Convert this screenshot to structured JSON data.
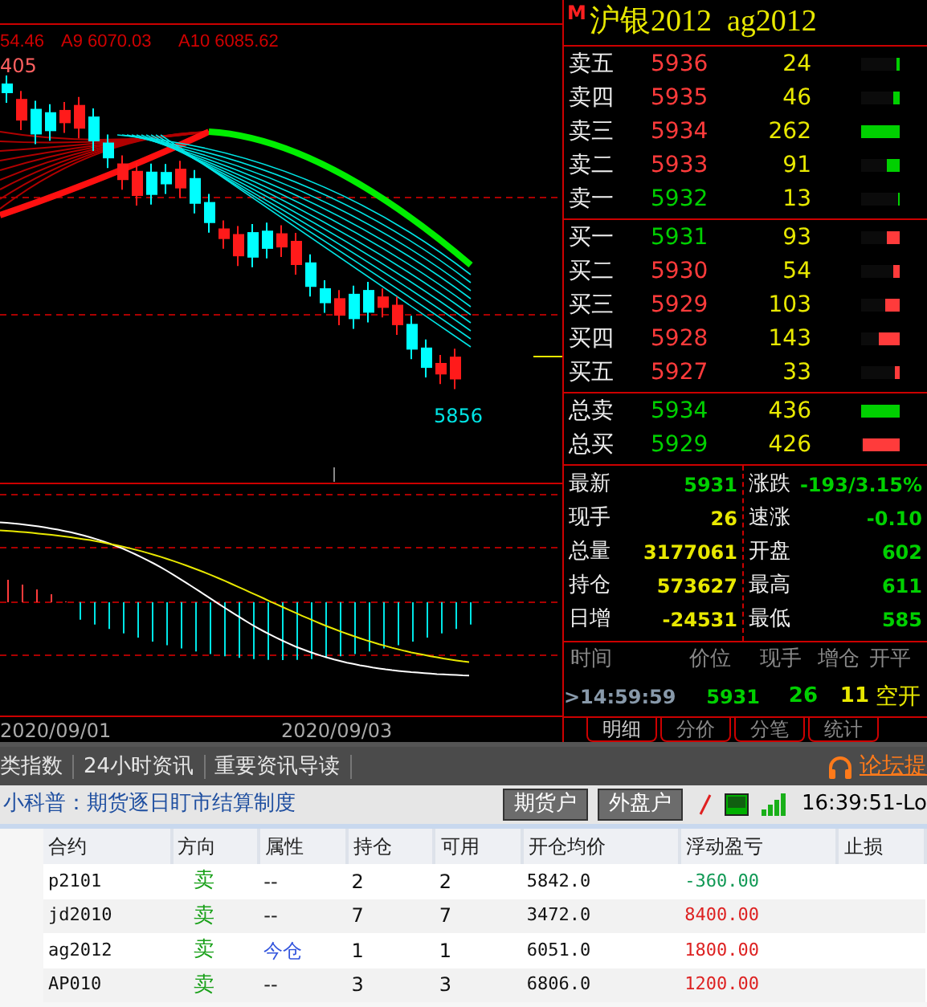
{
  "chart": {
    "ma_values": [
      "54.46",
      "A9 6070.03",
      "A10 6085.62"
    ],
    "high_label": "405",
    "low_label": "5856",
    "dates": [
      "2020/09/01",
      "2020/09/03"
    ]
  },
  "quote": {
    "badge": "M",
    "title": "沪银2012  ag2012",
    "asks": [
      {
        "label": "卖五",
        "price": "5936",
        "color": "#ff3b3b",
        "volume": "24",
        "level": 0.08,
        "kind": "sell"
      },
      {
        "label": "卖四",
        "price": "5935",
        "color": "#ff3b3b",
        "volume": "46",
        "level": 0.15,
        "kind": "sell"
      },
      {
        "label": "卖三",
        "price": "5934",
        "color": "#ff3b3b",
        "volume": "262",
        "level": 1,
        "kind": "sell"
      },
      {
        "label": "卖二",
        "price": "5933",
        "color": "#ff3b3b",
        "volume": "91",
        "level": 0.33,
        "kind": "sell"
      },
      {
        "label": "卖一",
        "price": "5932",
        "color": "#00d000",
        "volume": "13",
        "level": 0.04,
        "kind": "sell"
      }
    ],
    "bids": [
      {
        "label": "买一",
        "price": "5931",
        "color": "#00d000",
        "volume": "93",
        "level": 0.33,
        "kind": "buy"
      },
      {
        "label": "买二",
        "price": "5930",
        "color": "#ff3b3b",
        "volume": "54",
        "level": 0.17,
        "kind": "buy"
      },
      {
        "label": "买三",
        "price": "5929",
        "color": "#ff3b3b",
        "volume": "103",
        "level": 0.37,
        "kind": "buy"
      },
      {
        "label": "买四",
        "price": "5928",
        "color": "#ff3b3b",
        "volume": "143",
        "level": 0.53,
        "kind": "buy"
      },
      {
        "label": "买五",
        "price": "5927",
        "color": "#ff3b3b",
        "volume": "33",
        "level": 0.12,
        "kind": "buy"
      }
    ],
    "totals": [
      {
        "label": "总卖",
        "price": "5934",
        "color": "#00d000",
        "volume": "436",
        "level": 1,
        "kind": "sell"
      },
      {
        "label": "总买",
        "price": "5929",
        "color": "#00d000",
        "volume": "426",
        "level": 0.97,
        "kind": "buy"
      }
    ],
    "stats": [
      {
        "label": "最新",
        "value": "5931",
        "color": "#00d000"
      },
      {
        "label": "现手",
        "value": "26",
        "color": "#e8e800"
      },
      {
        "label": "总量",
        "value": "3177061",
        "color": "#e8e800"
      },
      {
        "label": "持仓",
        "value": "573627",
        "color": "#e8e800"
      },
      {
        "label": "日增",
        "value": "-24531",
        "color": "#e8e800"
      }
    ],
    "stats_2": [
      {
        "label": "涨跌",
        "value": "-193/3.15%",
        "color": "#00d000"
      },
      {
        "label": "速涨",
        "value": "-0.10",
        "color": "#00d000"
      },
      {
        "label": "开盘",
        "value": "602",
        "color": "#00d000"
      },
      {
        "label": "最高",
        "value": "611",
        "color": "#00d000"
      },
      {
        "label": "最低",
        "value": "585",
        "color": "#00d000"
      }
    ],
    "ticks_header": [
      "时间",
      "价位",
      "现手",
      "增仓",
      "开平"
    ],
    "ticks": [
      {
        "time": ">14:59:59",
        "price": "5931",
        "volume": "26",
        "change": "11",
        "type": "空开"
      }
    ],
    "tabs": [
      {
        "label": "明细",
        "selected": true
      },
      {
        "label": "分价",
        "selected": false
      },
      {
        "label": "分笔",
        "selected": false
      },
      {
        "label": "统计",
        "selected": false
      }
    ]
  },
  "news_bar": {
    "links": [
      "类指数",
      "24小时资讯",
      "重要资讯导读"
    ],
    "forum": "论坛提"
  },
  "status_bar": {
    "tip": "小科普：期货逐日盯市结算制度",
    "buttons": [
      "期货户",
      "外盘户"
    ],
    "time": "16:39:51-Lo"
  },
  "positions": {
    "columns": [
      "合约",
      "方向",
      "属性",
      "持仓",
      "可用",
      "开仓均价",
      "浮动盈亏",
      "止损"
    ],
    "rows": [
      {
        "contract": "p2101",
        "side": "卖",
        "attribute": "--",
        "highlighted": false,
        "holding": "2",
        "available": "2",
        "avg_price": "5842.0",
        "pnl": "-360.00",
        "color": "#119955"
      },
      {
        "contract": "jd2010",
        "side": "卖",
        "attribute": "--",
        "highlighted": false,
        "holding": "7",
        "available": "7",
        "avg_price": "3472.0",
        "pnl": "8400.00",
        "color": "#dd2222"
      },
      {
        "contract": "ag2012",
        "side": "卖",
        "attribute": "今仓",
        "highlighted": true,
        "holding": "1",
        "available": "1",
        "avg_price": "6051.0",
        "pnl": "1800.00",
        "color": "#dd2222"
      },
      {
        "contract": "AP010",
        "side": "卖",
        "attribute": "--",
        "highlighted": false,
        "holding": "3",
        "available": "3",
        "avg_price": "6806.0",
        "pnl": "1200.00",
        "color": "#dd2222"
      }
    ]
  }
}
